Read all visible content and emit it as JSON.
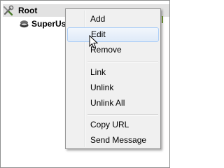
{
  "tree": {
    "root_label": "Root",
    "child_label": "SuperUs"
  },
  "menu": {
    "items": [
      {
        "label": "Add"
      },
      {
        "label": "Edit",
        "highlighted": true
      },
      {
        "label": "Remove"
      },
      {
        "label": "Link"
      },
      {
        "label": "Unlink"
      },
      {
        "label": "Unlink All"
      },
      {
        "label": "Copy URL"
      },
      {
        "label": "Send Message"
      }
    ]
  },
  "icons": {
    "root": "tools-icon",
    "child": "user-icon",
    "pointer": "mouse-cursor-icon"
  },
  "colors": {
    "highlight_border": "#aecff7",
    "menu_background": "#f0f0f0",
    "selected_row": "#e2e2e2"
  }
}
